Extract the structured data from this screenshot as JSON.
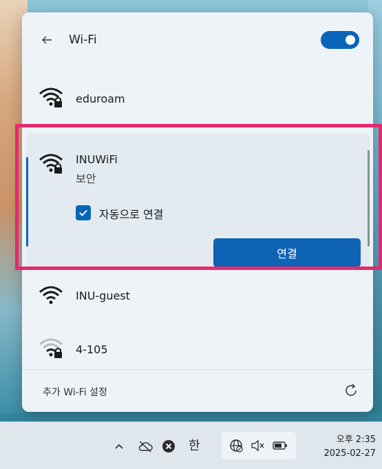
{
  "header": {
    "title": "Wi-Fi",
    "wifi_enabled": true
  },
  "networks": [
    {
      "name": "eduroam",
      "secured": true
    },
    {
      "name": "INUWiFi",
      "secured": true,
      "status": "보안",
      "selected": true
    },
    {
      "name": "INU-guest",
      "secured": false
    },
    {
      "name": "4-105",
      "secured": true,
      "weak": true
    }
  ],
  "selected": {
    "auto_connect_label": "자동으로 연결",
    "auto_connect_checked": true,
    "connect_label": "연결"
  },
  "footer": {
    "more_settings_label": "추가 Wi-Fi 설정"
  },
  "taskbar": {
    "ime_label": "한",
    "time": "오후 2:35",
    "date": "2025-02-27"
  },
  "colors": {
    "accent": "#0a64b8",
    "highlight": "#e6286e",
    "panel": "#eef3f7"
  },
  "icons": {
    "back": "arrow-left-icon",
    "wifi_secured": "wifi-lock-icon",
    "wifi": "wifi-icon",
    "refresh": "refresh-icon",
    "chevron": "chevron-up-icon",
    "cloud": "cloud-off-icon",
    "error": "x-circle-icon",
    "globe": "globe-icon",
    "mute": "volume-mute-icon",
    "battery": "battery-icon"
  }
}
